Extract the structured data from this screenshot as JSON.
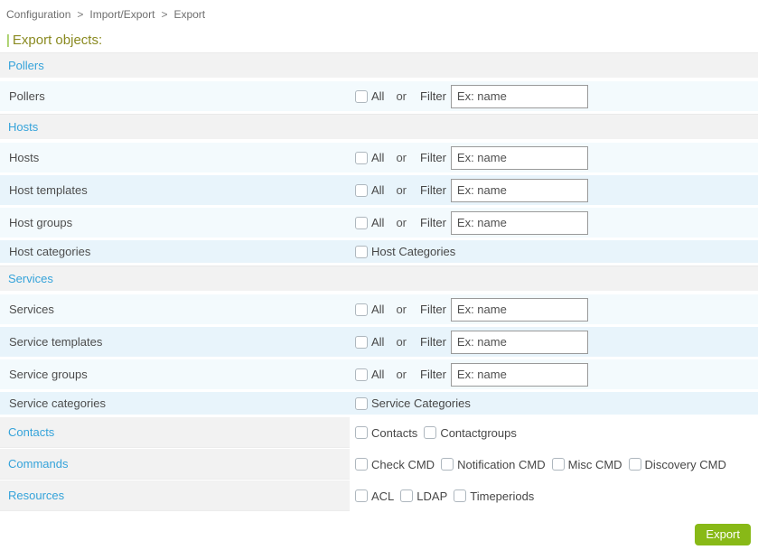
{
  "breadcrumb": {
    "separator": ">",
    "items": [
      "Configuration",
      "Import/Export",
      "Export"
    ]
  },
  "page": {
    "title_marker": "|",
    "title": "Export objects:"
  },
  "labels": {
    "all": "All",
    "or": "or",
    "filter": "Filter",
    "filter_placeholder": "Ex: name"
  },
  "sections": [
    {
      "header": "Pollers",
      "rows": [
        {
          "label": "Pollers"
        }
      ]
    },
    {
      "header": "Hosts",
      "rows": [
        {
          "label": "Hosts"
        },
        {
          "label": "Host templates"
        },
        {
          "label": "Host groups"
        },
        {
          "label": "Host categories",
          "checkbox_label": "Host Categories"
        }
      ]
    },
    {
      "header": "Services",
      "rows": [
        {
          "label": "Services"
        },
        {
          "label": "Service templates"
        },
        {
          "label": "Service groups"
        },
        {
          "label": "Service categories",
          "checkbox_label": "Service Categories"
        }
      ]
    }
  ],
  "groups": [
    {
      "label": "Contacts",
      "checkboxes": [
        "Contacts",
        "Contactgroups"
      ]
    },
    {
      "label": "Commands",
      "checkboxes": [
        "Check CMD",
        "Notification CMD",
        "Misc CMD",
        "Discovery CMD"
      ]
    },
    {
      "label": "Resources",
      "checkboxes": [
        "ACL",
        "LDAP",
        "Timeperiods"
      ]
    }
  ],
  "footer": {
    "export_button": "Export"
  },
  "colors": {
    "accent_green": "#88b917",
    "section_blue": "#35a3da",
    "title_olive": "#8a8a21",
    "title_bar_green": "#7db71c",
    "row_light": "#f3fafd",
    "row_dark": "#e8f4fb"
  }
}
